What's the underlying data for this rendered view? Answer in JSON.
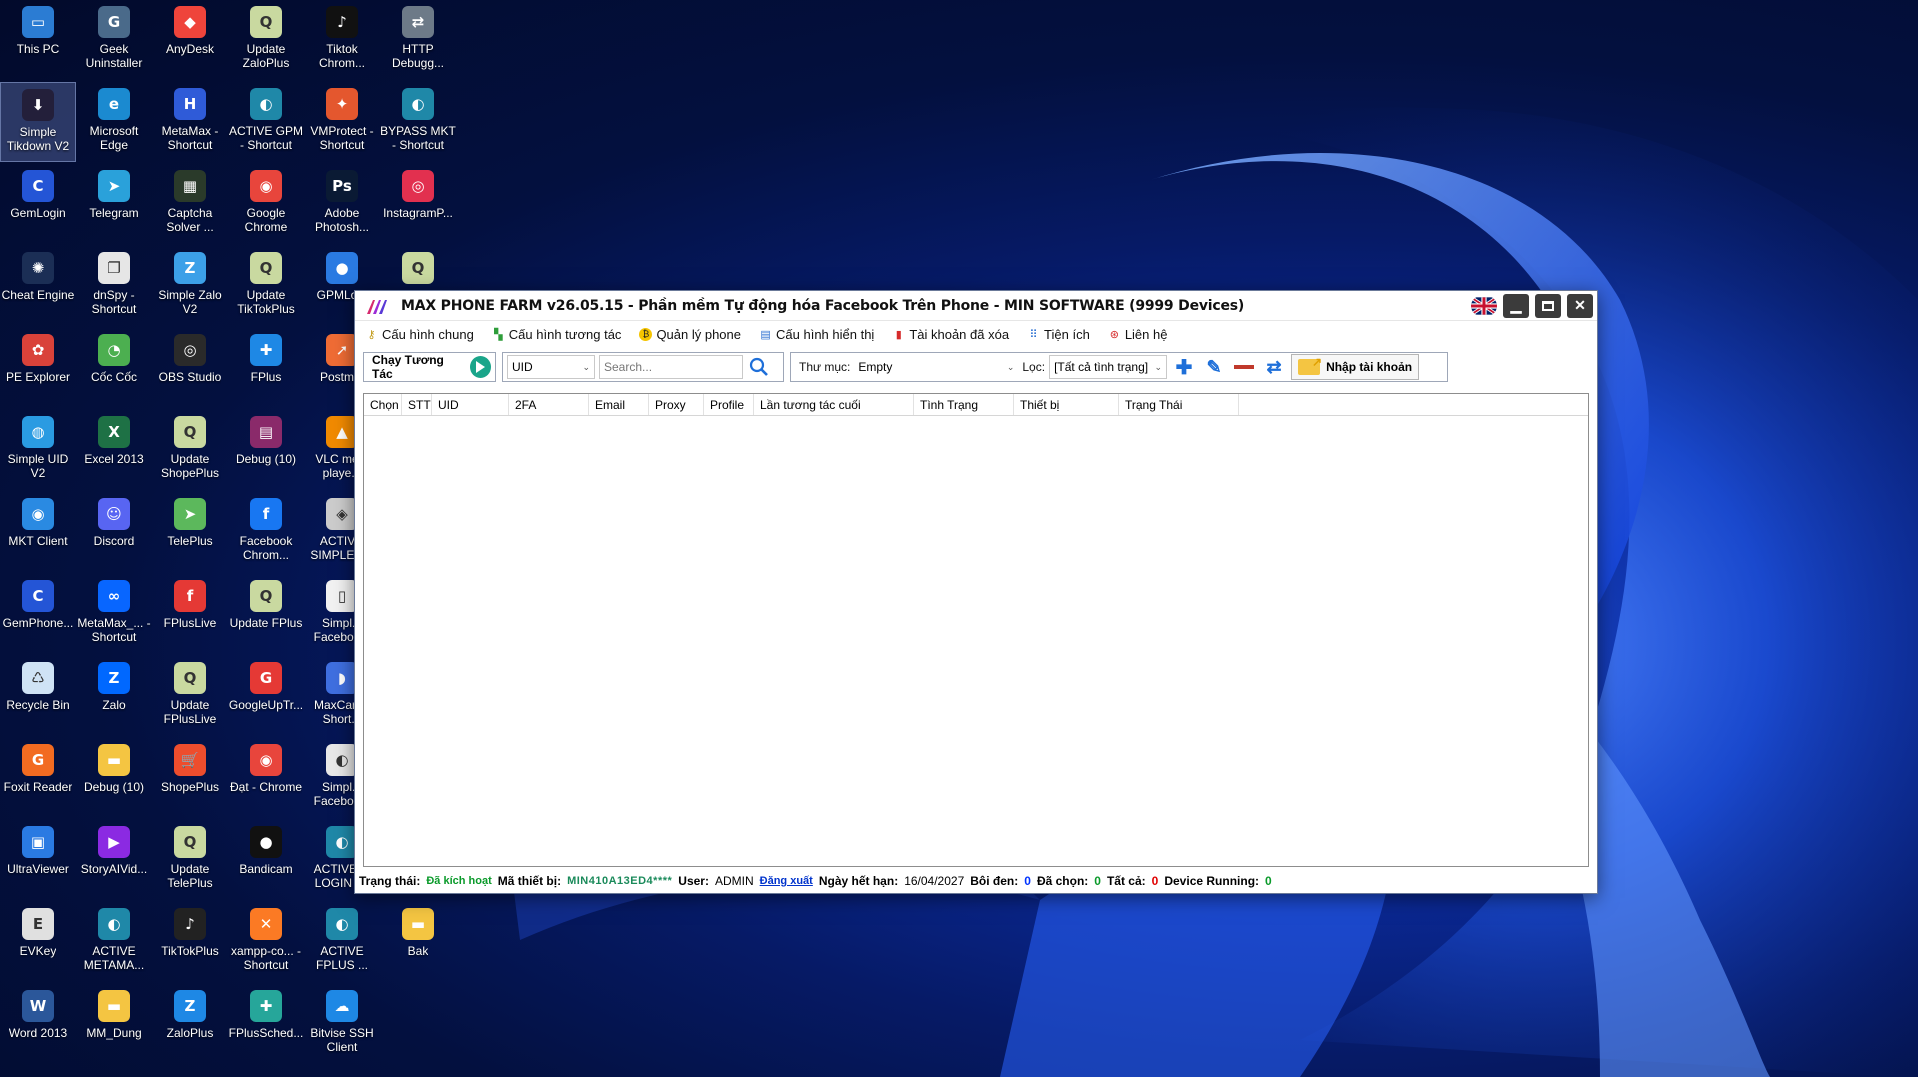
{
  "desktop": {
    "icons": [
      {
        "label": "This PC",
        "icon": "monitor-icon",
        "color": "#2b7cd3",
        "glyph": "▭"
      },
      {
        "label": "Geek Uninstaller",
        "icon": "geek-uninstaller-icon",
        "color": "#4a6a8a",
        "glyph": "G"
      },
      {
        "label": "AnyDesk",
        "icon": "anydesk-icon",
        "color": "#ef443b",
        "glyph": "◆"
      },
      {
        "label": "Update ZaloPlus",
        "icon": "update-icon",
        "color": "#c9d9a0",
        "glyph": "Q"
      },
      {
        "label": "Tiktok Chrom...",
        "icon": "tiktok-icon",
        "color": "#111111",
        "glyph": "♪"
      },
      {
        "label": "HTTP Debugg...",
        "icon": "http-debugger-icon",
        "color": "#6d7a88",
        "glyph": "⇄"
      },
      {
        "label": "Simple Tikdown V2",
        "icon": "tikdown-icon",
        "color": "#231f3a",
        "glyph": "⬇"
      },
      {
        "label": "Microsoft Edge",
        "icon": "edge-icon",
        "color": "#1b8ad0",
        "glyph": "e"
      },
      {
        "label": "MetaMax - Shortcut",
        "icon": "metamax-icon",
        "color": "#2f5bd8",
        "glyph": "H"
      },
      {
        "label": "ACTIVE GPM - Shortcut",
        "icon": "active-gpm-icon",
        "color": "#1f88a8",
        "glyph": "◐"
      },
      {
        "label": "VMProtect - Shortcut",
        "icon": "vmprotect-icon",
        "color": "#e4572e",
        "glyph": "✦"
      },
      {
        "label": "BYPASS MKT - Shortcut",
        "icon": "bypass-mkt-icon",
        "color": "#1f88a8",
        "glyph": "◐"
      },
      {
        "label": "GemLogin",
        "icon": "gemlogin-icon",
        "color": "#2455d6",
        "glyph": "C"
      },
      {
        "label": "Telegram",
        "icon": "telegram-icon",
        "color": "#2aa1da",
        "glyph": "➤"
      },
      {
        "label": "Captcha Solver ...",
        "icon": "captcha-icon",
        "color": "#2a3a2a",
        "glyph": "▦"
      },
      {
        "label": "Google Chrome",
        "icon": "chrome-icon",
        "color": "#e8453c",
        "glyph": "◉"
      },
      {
        "label": "Adobe Photosh...",
        "icon": "photoshop-icon",
        "color": "#0a1a34",
        "glyph": "Ps"
      },
      {
        "label": "InstagramP...",
        "icon": "instagram-icon",
        "color": "#e2304f",
        "glyph": "◎"
      },
      {
        "label": "Cheat Engine",
        "icon": "cheat-engine-icon",
        "color": "#1b2e55",
        "glyph": "✺"
      },
      {
        "label": "dnSpy - Shortcut",
        "icon": "dnspy-icon",
        "color": "#e6e6e6",
        "glyph": "❐"
      },
      {
        "label": "Simple Zalo V2",
        "icon": "zalo-icon",
        "color": "#3ca0e8",
        "glyph": "Z"
      },
      {
        "label": "Update TikTokPlus",
        "icon": "update-icon",
        "color": "#c9d9a0",
        "glyph": "Q"
      },
      {
        "label": "GPMLo...",
        "icon": "gpmlogin-icon",
        "color": "#2a7ae2",
        "glyph": "●"
      },
      {
        "label": "",
        "icon": "update-icon",
        "color": "#c9d9a0",
        "glyph": "Q"
      },
      {
        "label": "PE Explorer",
        "icon": "pe-explorer-icon",
        "color": "#d9423a",
        "glyph": "✿"
      },
      {
        "label": "Cốc Cốc",
        "icon": "coccoc-icon",
        "color": "#4caf50",
        "glyph": "◔"
      },
      {
        "label": "OBS Studio",
        "icon": "obs-icon",
        "color": "#2a2a2a",
        "glyph": "◎"
      },
      {
        "label": "FPlus",
        "icon": "fplus-icon",
        "color": "#1e88e5",
        "glyph": "✚"
      },
      {
        "label": "Postm...",
        "icon": "postman-icon",
        "color": "#ef6c35",
        "glyph": "➚"
      },
      {
        "label": "Simple UID V2",
        "icon": "simple-uid-icon",
        "color": "#2a9be2",
        "glyph": "◍"
      },
      {
        "label": "Excel 2013",
        "icon": "excel-icon",
        "color": "#1e7145",
        "glyph": "X"
      },
      {
        "label": "Update ShopePlus",
        "icon": "update-icon",
        "color": "#c9d9a0",
        "glyph": "Q"
      },
      {
        "label": "Debug (10)",
        "icon": "winrar-icon",
        "color": "#8a2a6a",
        "glyph": "▤"
      },
      {
        "label": "VLC me... playe...",
        "icon": "vlc-icon",
        "color": "#f18a00",
        "glyph": "▲"
      },
      {
        "label": "MKT Client",
        "icon": "mkt-client-icon",
        "color": "#2a8ae2",
        "glyph": "◉"
      },
      {
        "label": "Discord",
        "icon": "discord-icon",
        "color": "#5865f2",
        "glyph": "☺"
      },
      {
        "label": "TelePlus",
        "icon": "teleplus-icon",
        "color": "#5cb85c",
        "glyph": "➤"
      },
      {
        "label": "Facebook Chrom...",
        "icon": "facebook-chrome-icon",
        "color": "#1877f2",
        "glyph": "f"
      },
      {
        "label": "ACTIV... SIMPLE F...",
        "icon": "active-simple-icon",
        "color": "#cccccc",
        "glyph": "◈"
      },
      {
        "label": "GemPhone...",
        "icon": "gemphone-icon",
        "color": "#2455d6",
        "glyph": "C"
      },
      {
        "label": "MetaMax_... - Shortcut",
        "icon": "meta-icon",
        "color": "#0866ff",
        "glyph": "∞"
      },
      {
        "label": "FPlusLive",
        "icon": "fpluslive-icon",
        "color": "#e53935",
        "glyph": "f"
      },
      {
        "label": "Update FPlus",
        "icon": "update-icon",
        "color": "#c9d9a0",
        "glyph": "Q"
      },
      {
        "label": "Simpl... Faceboo...",
        "icon": "file-icon",
        "color": "#f2f2f2",
        "glyph": "▯"
      },
      {
        "label": "Recycle Bin",
        "icon": "recycle-bin-icon",
        "color": "#cfe3f5",
        "glyph": "♺"
      },
      {
        "label": "Zalo",
        "icon": "zalo-icon",
        "color": "#0068ff",
        "glyph": "Z"
      },
      {
        "label": "Update FPlusLive",
        "icon": "update-icon",
        "color": "#c9d9a0",
        "glyph": "Q"
      },
      {
        "label": "GoogleUpTr...",
        "icon": "googleuptr-icon",
        "color": "#e53935",
        "glyph": "G"
      },
      {
        "label": "MaxCare - Short...",
        "icon": "maxcare-icon",
        "color": "#3f6fe0",
        "glyph": "◗"
      },
      {
        "label": "Foxit Reader",
        "icon": "foxit-icon",
        "color": "#f26b21",
        "glyph": "G"
      },
      {
        "label": "Debug (10)",
        "icon": "folder-icon",
        "color": "#f4c542",
        "glyph": "▬"
      },
      {
        "label": "ShopePlus",
        "icon": "shopeplus-icon",
        "color": "#ee4d2d",
        "glyph": "🛒"
      },
      {
        "label": "Đạt - Chrome",
        "icon": "chrome-profile-icon",
        "color": "#e8453c",
        "glyph": "◉"
      },
      {
        "label": "Simpl... Faceboo...",
        "icon": "simple-facebook-icon",
        "color": "#e8e8e8",
        "glyph": "◐"
      },
      {
        "label": "UltraViewer",
        "icon": "ultraviewer-icon",
        "color": "#2a7ae2",
        "glyph": "▣"
      },
      {
        "label": "StoryAIVid...",
        "icon": "storyai-icon",
        "color": "#8b2ae2",
        "glyph": "▶"
      },
      {
        "label": "Update TelePlus",
        "icon": "update-icon",
        "color": "#c9d9a0",
        "glyph": "Q"
      },
      {
        "label": "Bandicam",
        "icon": "bandicam-icon",
        "color": "#111111",
        "glyph": "●"
      },
      {
        "label": "ACTIVE ... LOGIN -...",
        "icon": "active-login-icon",
        "color": "#1f88a8",
        "glyph": "◐"
      },
      {
        "label": "EVKey",
        "icon": "evkey-icon",
        "color": "#e0e0e0",
        "glyph": "E"
      },
      {
        "label": "ACTIVE METAMA...",
        "icon": "active-metamax-icon",
        "color": "#1f88a8",
        "glyph": "◐"
      },
      {
        "label": "TikTokPlus",
        "icon": "tiktokplus-icon",
        "color": "#222222",
        "glyph": "♪"
      },
      {
        "label": "xampp-co... - Shortcut",
        "icon": "xampp-icon",
        "color": "#fb7a24",
        "glyph": "✕"
      },
      {
        "label": "ACTIVE FPLUS ...",
        "icon": "active-fplus-icon",
        "color": "#1f88a8",
        "glyph": "◐"
      },
      {
        "label": "Bak",
        "icon": "folder-icon",
        "color": "#f4c542",
        "glyph": "▬"
      },
      {
        "label": "Word 2013",
        "icon": "word-icon",
        "color": "#2b579a",
        "glyph": "W"
      },
      {
        "label": "MM_Dung",
        "icon": "folder-icon",
        "color": "#f4c542",
        "glyph": "▬"
      },
      {
        "label": "ZaloPlus",
        "icon": "zaloplus-icon",
        "color": "#1e88e5",
        "glyph": "Z"
      },
      {
        "label": "FPlusSched...",
        "icon": "fplussched-icon",
        "color": "#26a69a",
        "glyph": "✚"
      },
      {
        "label": "Bitvise SSH Client",
        "icon": "bitvise-icon",
        "color": "#1e88e5",
        "glyph": "☁"
      }
    ]
  },
  "app": {
    "title": "MAX PHONE FARM v26.05.15 - Phần mềm Tự động hóa Facebook Trên Phone - MIN SOFTWARE (9999 Devices)",
    "menu": [
      {
        "label": "Cấu hình chung",
        "icon": "key-icon"
      },
      {
        "label": "Cấu hình tương tác",
        "icon": "interaction-icon"
      },
      {
        "label": "Quản lý phone",
        "icon": "phone-manage-icon"
      },
      {
        "label": "Cấu hình hiển thị",
        "icon": "display-config-icon"
      },
      {
        "label": "Tài khoản đã xóa",
        "icon": "deleted-account-icon"
      },
      {
        "label": "Tiện ích",
        "icon": "utilities-icon"
      },
      {
        "label": "Liên hệ",
        "icon": "contact-icon"
      }
    ],
    "toolbar": {
      "run_label": "Chạy Tương Tác",
      "filter_field": "UID",
      "search_placeholder": "Search...",
      "folder_label": "Thư mục:",
      "folder_value": "Empty",
      "filter_label": "Lọc:",
      "status_filter_value": "[Tất cả tình trạng]",
      "import_label": "Nhập tài khoản"
    },
    "grid": {
      "columns": [
        "Chọn",
        "STT",
        "UID",
        "2FA",
        "Email",
        "Proxy",
        "Profile",
        "Lần tương tác cuối",
        "Tình Trạng",
        "Thiết bị",
        "Trạng Thái"
      ]
    },
    "status": {
      "state_label": "Trạng thái:",
      "state_value": "Đã kích hoạt",
      "device_code_label": "Mã thiết bị:",
      "device_code_value": "MIN410A13ED4****",
      "user_label": "User:",
      "user_value": "ADMIN",
      "logout_label": "Đăng xuất",
      "expiry_label": "Ngày hết hạn:",
      "expiry_value": "16/04/2027",
      "highlighted_label": "Bôi đen:",
      "highlighted_value": "0",
      "selected_label": "Đã chọn:",
      "selected_value": "0",
      "total_label": "Tất cả:",
      "total_value": "0",
      "running_label": "Device Running:",
      "running_value": "0"
    }
  },
  "colors": {
    "play_button": "#1aa58a",
    "status_green": "#0a9a2a",
    "status_blue": "#0033ff",
    "status_red": "#e00000",
    "add_icon": "#1e6fd9",
    "remove_icon": "#c0392b"
  }
}
